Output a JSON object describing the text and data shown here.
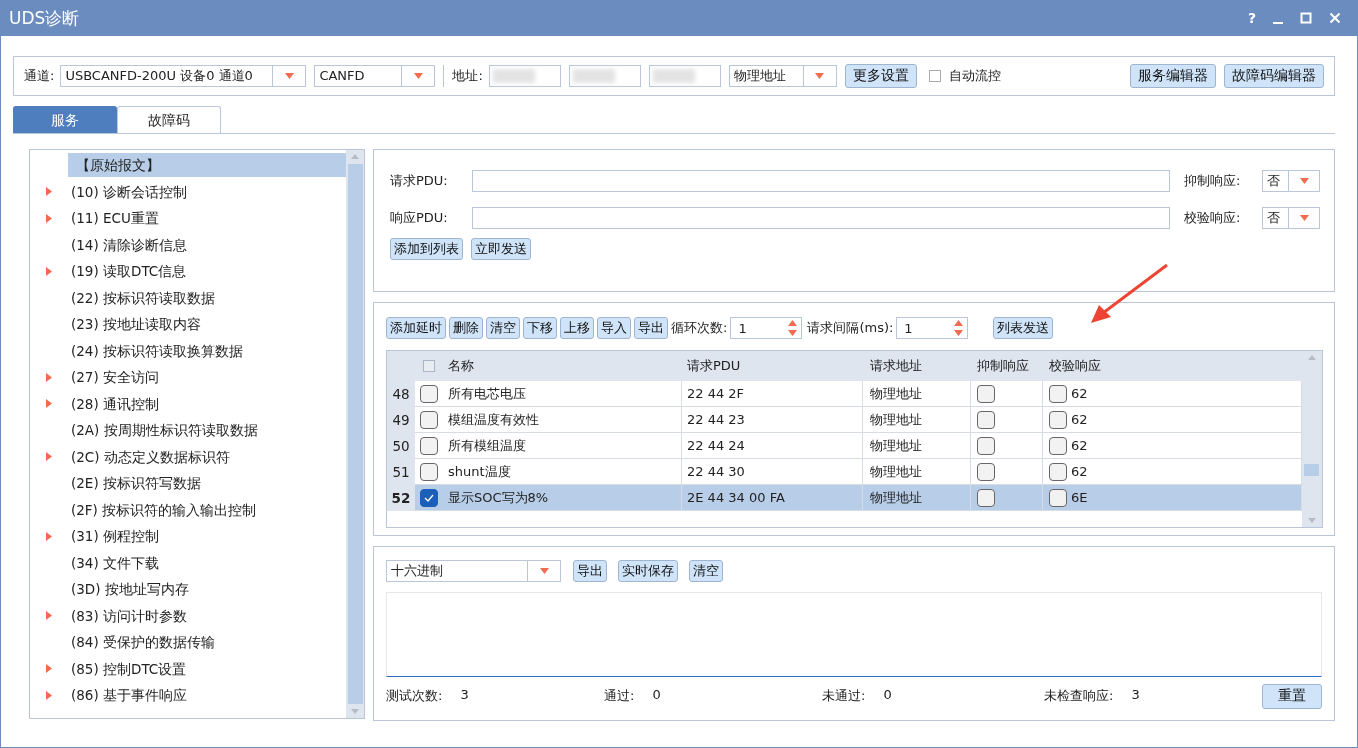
{
  "window": {
    "title": "UDS诊断",
    "controls": [
      "?"
    ]
  },
  "toolbar": {
    "channel_label": "通道:",
    "channel": "USBCANFD-200U 设备0 通道0",
    "protocol": "CANFD",
    "address_label": "地址:",
    "address_type": "物理地址",
    "more_settings": "更多设置",
    "auto_flow": {
      "label": "自动流控",
      "checked": false
    },
    "service_editor": "服务编辑器",
    "dtc_editor": "故障码编辑器"
  },
  "tabs": [
    {
      "label": "服务",
      "selected": true
    },
    {
      "label": "故障码",
      "selected": false
    }
  ],
  "service_tree": [
    {
      "label": "【原始报文】",
      "expandable": false,
      "selected": true
    },
    {
      "label": "(10) 诊断会话控制",
      "expandable": true,
      "selected": false
    },
    {
      "label": "(11) ECU重置",
      "expandable": true,
      "selected": false
    },
    {
      "label": "(14) 清除诊断信息",
      "expandable": false,
      "selected": false
    },
    {
      "label": "(19) 读取DTC信息",
      "expandable": true,
      "selected": false
    },
    {
      "label": "(22) 按标识符读取数据",
      "expandable": false,
      "selected": false
    },
    {
      "label": "(23) 按地址读取内容",
      "expandable": false,
      "selected": false
    },
    {
      "label": "(24) 按标识符读取换算数据",
      "expandable": false,
      "selected": false
    },
    {
      "label": "(27) 安全访问",
      "expandable": true,
      "selected": false
    },
    {
      "label": "(28) 通讯控制",
      "expandable": true,
      "selected": false
    },
    {
      "label": "(2A) 按周期性标识符读取数据",
      "expandable": false,
      "selected": false
    },
    {
      "label": "(2C) 动态定义数据标识符",
      "expandable": true,
      "selected": false
    },
    {
      "label": "(2E) 按标识符写数据",
      "expandable": false,
      "selected": false
    },
    {
      "label": "(2F) 按标识符的输入输出控制",
      "expandable": false,
      "selected": false
    },
    {
      "label": "(31) 例程控制",
      "expandable": true,
      "selected": false
    },
    {
      "label": "(34) 文件下载",
      "expandable": false,
      "selected": false
    },
    {
      "label": "(3D) 按地址写内存",
      "expandable": false,
      "selected": false
    },
    {
      "label": "(83) 访问计时参数",
      "expandable": true,
      "selected": false
    },
    {
      "label": "(84) 受保护的数据传输",
      "expandable": false,
      "selected": false
    },
    {
      "label": "(85) 控制DTC设置",
      "expandable": true,
      "selected": false
    },
    {
      "label": "(86) 基于事件响应",
      "expandable": true,
      "selected": false
    }
  ],
  "request_panel": {
    "request_label": "请求PDU:",
    "suppress_label": "抑制响应:",
    "suppress_value": "否",
    "response_label": "响应PDU:",
    "verify_label": "校验响应:",
    "verify_value": "否",
    "buttons": [
      "添加到列表",
      "立即发送"
    ]
  },
  "list_panel": {
    "buttons": [
      "添加延时",
      "删除",
      "清空",
      "下移",
      "上移",
      "导入",
      "导出"
    ],
    "loop_label": "循环次数:",
    "loop_value": "1",
    "interval_label": "请求间隔(ms):",
    "interval_value": "1",
    "send_button": "列表发送",
    "table": {
      "all_checked": false,
      "columns": [
        "名称",
        "请求PDU",
        "请求地址",
        "抑制响应",
        "校验响应"
      ],
      "rows": [
        {
          "index": "48",
          "checked": false,
          "name": "所有电芯电压",
          "pdu": "22 44 2F",
          "address": "物理地址",
          "suppress": false,
          "verify": false,
          "verify_value": "62",
          "selected": false
        },
        {
          "index": "49",
          "checked": false,
          "name": "模组温度有效性",
          "pdu": "22 44 23",
          "address": "物理地址",
          "suppress": false,
          "verify": false,
          "verify_value": "62",
          "selected": false
        },
        {
          "index": "50",
          "checked": false,
          "name": "所有模组温度",
          "pdu": "22 44 24",
          "address": "物理地址",
          "suppress": false,
          "verify": false,
          "verify_value": "62",
          "selected": false
        },
        {
          "index": "51",
          "checked": false,
          "name": "shunt温度",
          "pdu": "22 44 30",
          "address": "物理地址",
          "suppress": false,
          "verify": false,
          "verify_value": "62",
          "selected": false
        },
        {
          "index": "52",
          "checked": true,
          "name": "显示SOC写为8%",
          "pdu": "2E 44 34 00 FA",
          "address": "物理地址",
          "suppress": false,
          "verify": false,
          "verify_value": "6E",
          "selected": true
        }
      ]
    }
  },
  "output_panel": {
    "format": "十六进制",
    "buttons": [
      "导出",
      "实时保存",
      "清空"
    ],
    "stats": [
      {
        "label": "测试次数:",
        "value": "3"
      },
      {
        "label": "通过:",
        "value": "0"
      },
      {
        "label": "未通过:",
        "value": "0"
      },
      {
        "label": "未检查响应:",
        "value": "3"
      }
    ],
    "reset_button": "重置"
  }
}
